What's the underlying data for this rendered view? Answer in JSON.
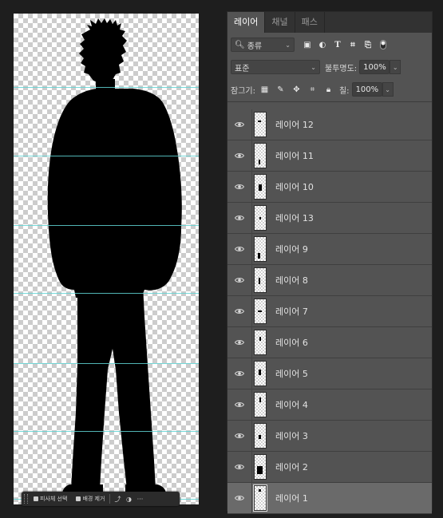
{
  "canvas": {
    "taskbar": {
      "select_subject_label": "피사체 선택",
      "remove_bg_label": "배경 제거",
      "more_label": "···"
    }
  },
  "panel": {
    "tabs": [
      {
        "label": "레이어",
        "active": true
      },
      {
        "label": "채널",
        "active": false
      },
      {
        "label": "패스",
        "active": false
      }
    ],
    "filter": {
      "kind_label": "종류",
      "icons": [
        "image-filter-icon",
        "adjustment-filter-icon",
        "type-filter-icon",
        "shape-filter-icon",
        "smart-object-filter-icon",
        "filter-toggle-icon"
      ]
    },
    "blend": {
      "mode": "표준",
      "opacity_label": "불투명도:",
      "opacity_value": "100%"
    },
    "lock": {
      "label": "잠그기:",
      "icons": [
        "lock-transparent-icon",
        "lock-image-icon",
        "lock-position-icon",
        "lock-artboard-icon",
        "lock-all-icon"
      ],
      "fill_label": "칠:",
      "fill_value": "100%"
    },
    "layers": [
      {
        "name": "레이어 12",
        "selected": false
      },
      {
        "name": "레이어 11",
        "selected": false
      },
      {
        "name": "레이어 10",
        "selected": false
      },
      {
        "name": "레이어 13",
        "selected": false
      },
      {
        "name": "레이어 9",
        "selected": false
      },
      {
        "name": "레이어 8",
        "selected": false
      },
      {
        "name": "레이어 7",
        "selected": false
      },
      {
        "name": "레이어 6",
        "selected": false
      },
      {
        "name": "레이어 5",
        "selected": false
      },
      {
        "name": "레이어 4",
        "selected": false
      },
      {
        "name": "레이어 3",
        "selected": false
      },
      {
        "name": "레이어 2",
        "selected": false
      },
      {
        "name": "레이어 1",
        "selected": true
      }
    ]
  },
  "colors": {
    "guide": "#5fd3d3",
    "panel_bg": "#535353",
    "selected_layer": "#6a6a6a"
  }
}
